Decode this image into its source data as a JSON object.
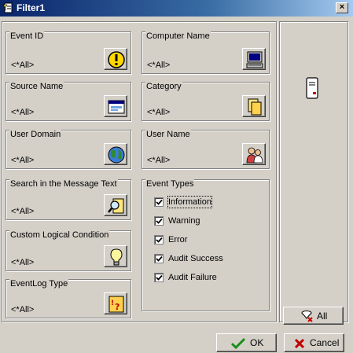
{
  "window": {
    "title": "Filter1",
    "close_label": "×"
  },
  "groups": {
    "event_id": {
      "label": "Event ID",
      "value": "<*All>",
      "icon": "exclamation-icon"
    },
    "computer_name": {
      "label": "Computer Name",
      "value": "<*All>",
      "icon": "computer-icon"
    },
    "source_name": {
      "label": "Source Name",
      "value": "<*All>",
      "icon": "window-icon"
    },
    "category": {
      "label": "Category",
      "value": "<*All>",
      "icon": "documents-icon"
    },
    "user_domain": {
      "label": "User Domain",
      "value": "<*All>",
      "icon": "globe-icon"
    },
    "user_name": {
      "label": "User Name",
      "value": "<*All>",
      "icon": "users-icon"
    },
    "search_message": {
      "label": "Search in the Message Text",
      "value": "<*All>",
      "icon": "magnifier-icon"
    },
    "custom_condition": {
      "label": "Custom Logical Condition",
      "value": "<*All>",
      "icon": "lightbulb-icon"
    },
    "eventlog_type": {
      "label": "EventLog Type",
      "value": "<*All>",
      "icon": "question-doc-icon"
    }
  },
  "event_types": {
    "label": "Event Types",
    "items": [
      {
        "label": "Information",
        "checked": true
      },
      {
        "label": "Warning",
        "checked": true
      },
      {
        "label": "Error",
        "checked": true
      },
      {
        "label": "Audit Success",
        "checked": true
      },
      {
        "label": "Audit Failure",
        "checked": true
      }
    ]
  },
  "buttons": {
    "all": "All",
    "ok": "OK",
    "cancel": "Cancel"
  }
}
